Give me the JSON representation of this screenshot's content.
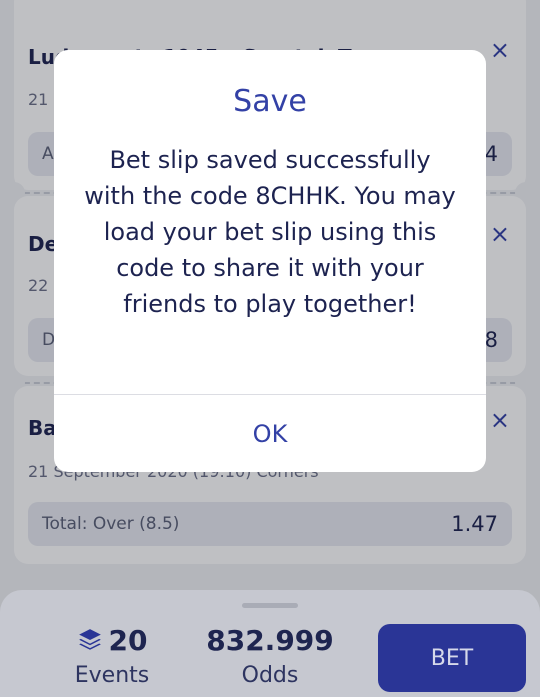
{
  "bets": [
    {
      "teams": "Ludogorets 1945 – Spartak Tyrnava",
      "date": "21",
      "pick": "A",
      "odds": "4"
    },
    {
      "teams": "De",
      "date": "22",
      "pick": "D",
      "odds": "8"
    },
    {
      "teams": "Ba",
      "date": "21 September 2020 (19:10) Corners",
      "pick": "Total: Over (8.5)",
      "odds": "1.47"
    }
  ],
  "close_glyph": "×",
  "dialog": {
    "title": "Save",
    "message": "Bet slip saved successfully with the code 8CHHK. You may load your bet slip using this code to share it with your friends to play together!",
    "ok_label": "OK"
  },
  "footer": {
    "events_count": "20",
    "events_label": "Events",
    "odds_value": "832.999",
    "odds_label": "Odds",
    "bet_label": "BET"
  },
  "colors": {
    "accent": "#3341a6",
    "bet_button": "#2a3596",
    "text_dark": "#1d2350"
  }
}
